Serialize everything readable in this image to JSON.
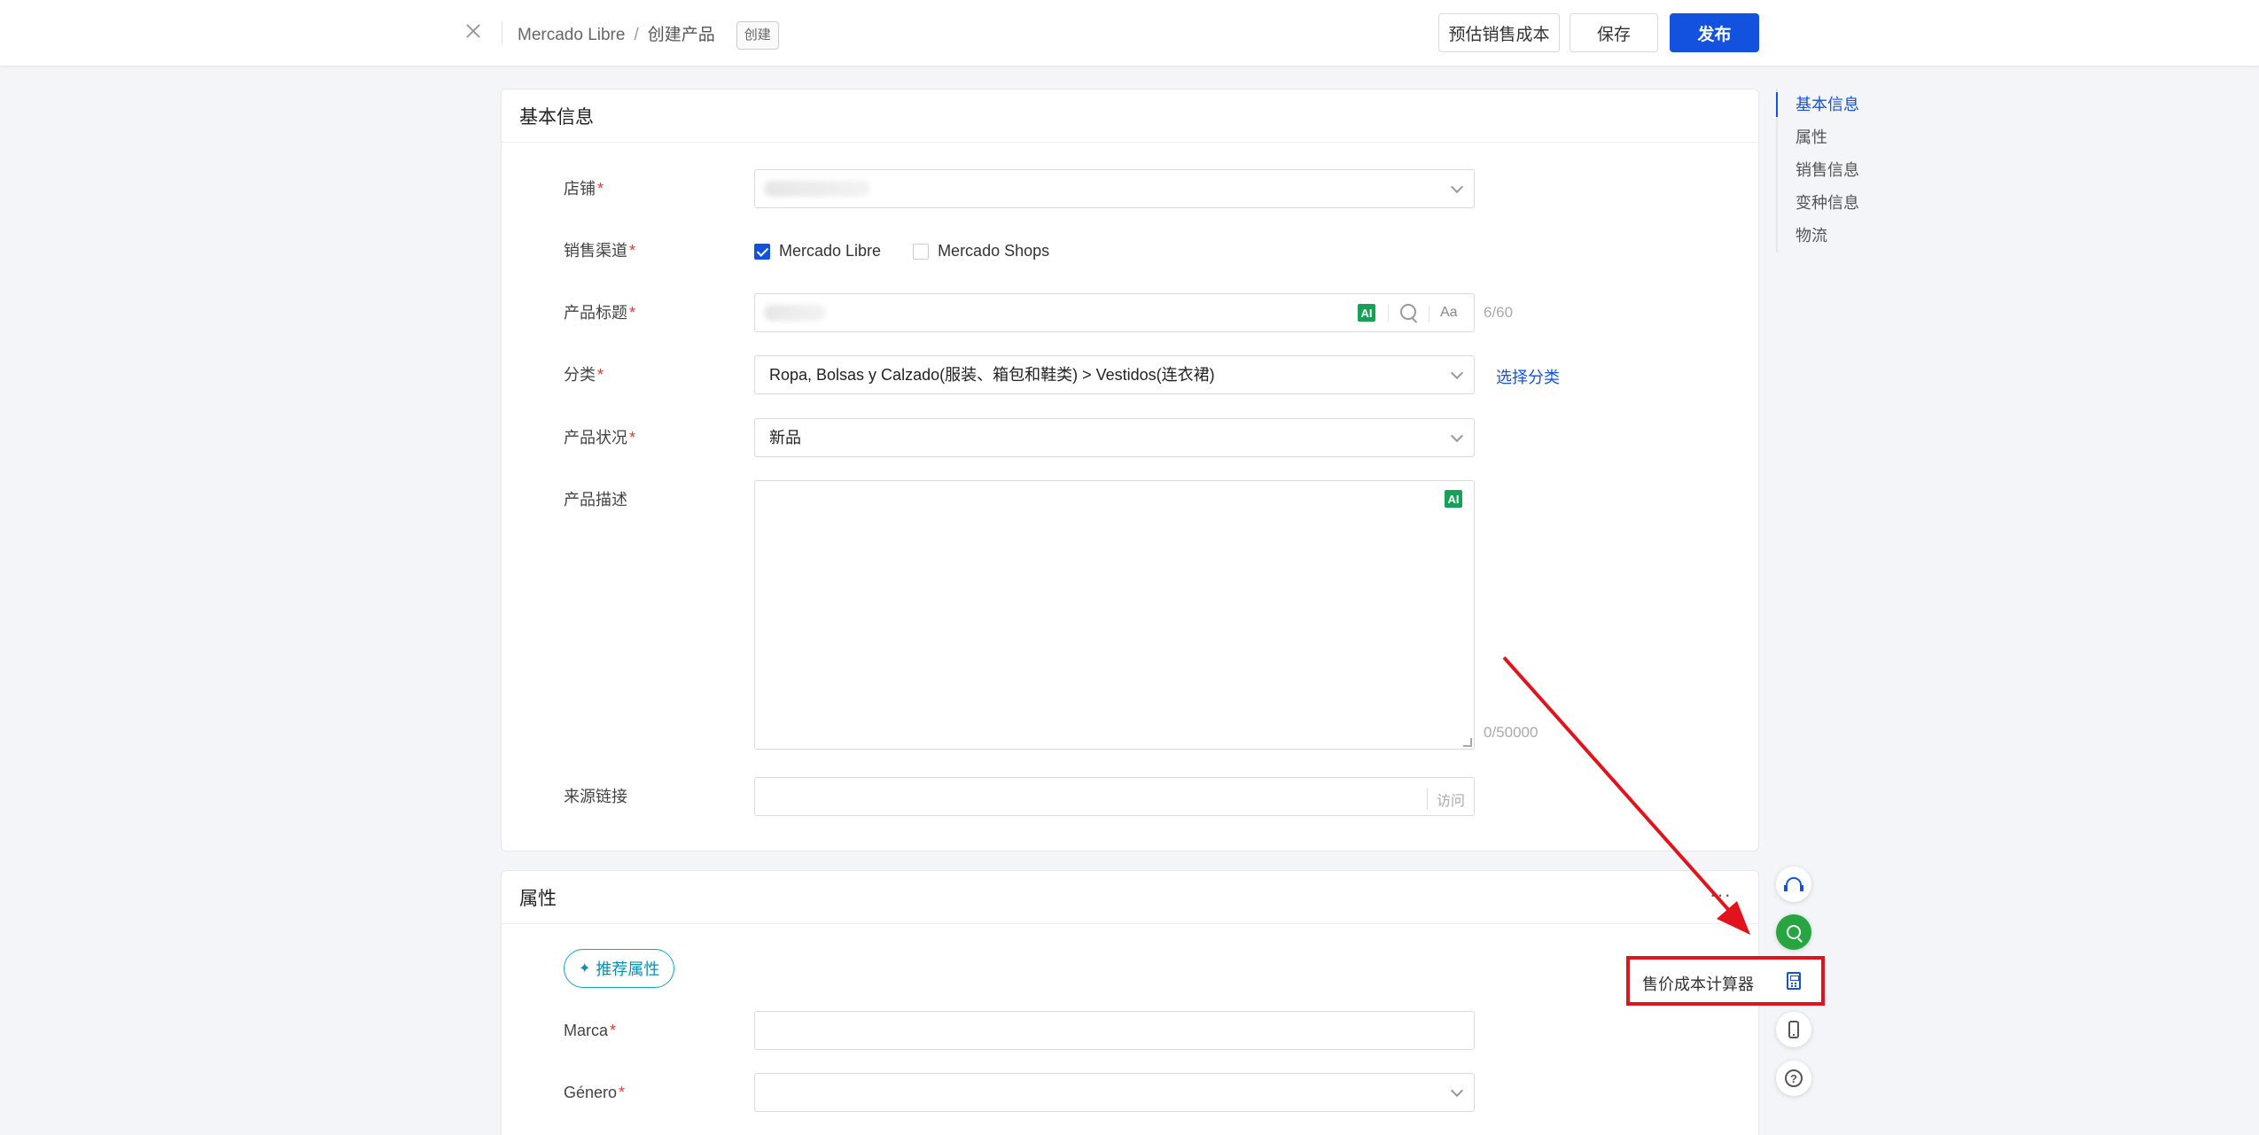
{
  "header": {
    "breadcrumb_root": "Mercado Libre",
    "breadcrumb_sep": "/",
    "breadcrumb_current": "创建产品",
    "mode_badge": "创建",
    "estimate_label": "预估销售成本",
    "save_label": "保存",
    "publish_label": "发布"
  },
  "basic": {
    "title": "基本信息",
    "shop_label": "店铺",
    "channel_label": "销售渠道",
    "channels": [
      {
        "label": "Mercado Libre",
        "checked": true
      },
      {
        "label": "Mercado Shops",
        "checked": false
      }
    ],
    "title_label": "产品标题",
    "title_counter": "6/60",
    "ai_label": "AI",
    "aa_label": "Aa",
    "category_label": "分类",
    "category_value": "Ropa, Bolsas y Calzado(服装、箱包和鞋类) > Vestidos(连衣裙)",
    "select_category_link": "选择分类",
    "condition_label": "产品状况",
    "condition_value": "新品",
    "desc_label": "产品描述",
    "desc_counter": "0/50000",
    "source_label": "来源链接",
    "visit_label": "访问",
    "required_mark": "*"
  },
  "attributes": {
    "title": "属性",
    "more": "···",
    "recommend_label": "推荐属性",
    "brand_label": "Marca",
    "gender_label": "Género"
  },
  "anchor_nav": [
    "基本信息",
    "属性",
    "销售信息",
    "变种信息",
    "物流"
  ],
  "float_tools": {
    "calculator_tooltip": "售价成本计算器",
    "help_glyph": "?"
  },
  "colors": {
    "primary": "#1352de",
    "annotation_red": "#e1141e",
    "ai_green": "#18a058",
    "search_green": "#26a541"
  }
}
